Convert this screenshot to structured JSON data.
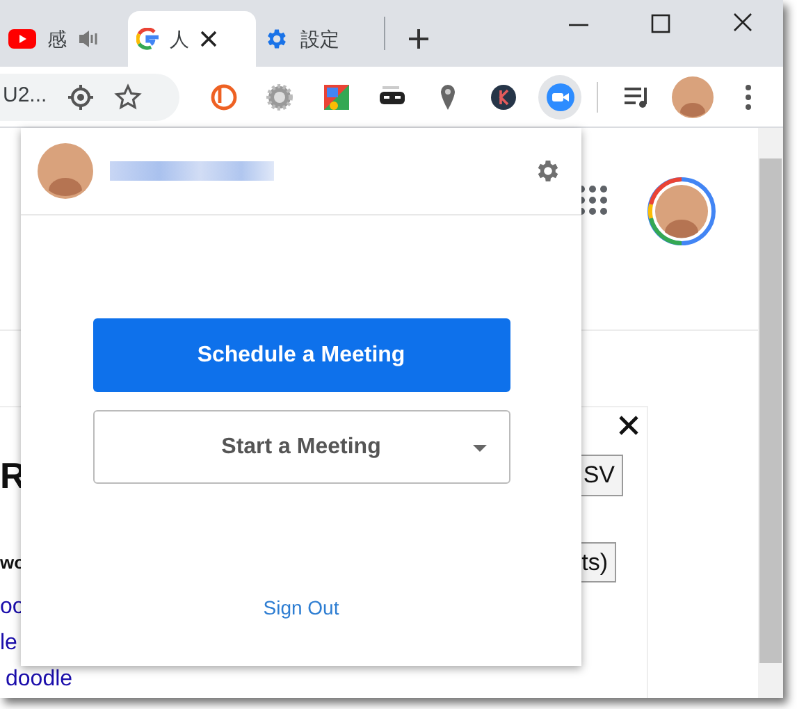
{
  "tabs": [
    {
      "kind": "youtube",
      "label": "感",
      "audio": true,
      "selected": false
    },
    {
      "kind": "google",
      "label": "人",
      "audio": false,
      "selected": true
    },
    {
      "kind": "settings",
      "label": "設定",
      "audio": false,
      "selected": false
    }
  ],
  "address_bar": {
    "text": "U2..."
  },
  "page": {
    "heading": "R",
    "bold_text": "wo",
    "links": [
      "oo",
      "le",
      "doodle"
    ],
    "buttons": [
      "SV",
      "ts)"
    ]
  },
  "popup": {
    "primary_button": "Schedule a Meeting",
    "secondary_button": "Start a Meeting",
    "link": "Sign Out"
  }
}
